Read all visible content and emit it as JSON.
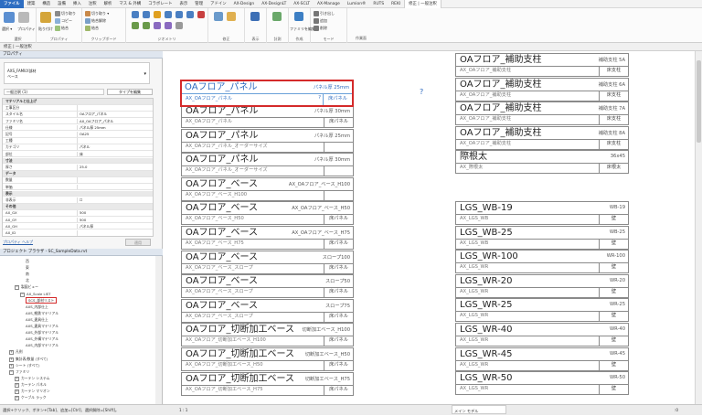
{
  "menu": [
    "ファイル",
    "建築",
    "構造",
    "設備",
    "挿入",
    "注釈",
    "解析",
    "マス & 外構",
    "コラボレート",
    "表示",
    "管理",
    "アドイン",
    "AX-Design",
    "AX-DesignLT",
    "AX-SCLT",
    "AX-Manage",
    "Lumion®",
    "RUTS",
    "REKI",
    "修正 | 一般注釈"
  ],
  "ribbon": {
    "groups": [
      "選択",
      "プロパティ",
      "クリップボード",
      "ジオメトリ",
      "修正",
      "表示",
      "計測",
      "作成",
      "モード",
      "作業面"
    ],
    "select_label": "選択 ▾",
    "prop_label": "プロパティ",
    "paste_label": "貼り付け",
    "clip_items": [
      "切り取り",
      "コピー",
      "結合"
    ],
    "geo_items": [
      "切り取り ▾",
      "結合解除",
      "結合"
    ],
    "mode_label": "ファミリを編集",
    "work_items": [
      "引き出し",
      "追加",
      "削除"
    ]
  },
  "context_bar": "修正 | 一般注釈",
  "properties": {
    "title": "プロパティ",
    "family_name": "AXS_FAMILY部材",
    "family_sub": "ベース",
    "filter": "一般注釈 (1)",
    "edit_type": "タイプを編集",
    "rows": [
      {
        "k": "マテリアルと仕上げ",
        "v": "",
        "sec": true
      },
      {
        "k": "工事区分",
        "v": ""
      },
      {
        "k": "スタイル名",
        "v": "OAフロア_パネル"
      },
      {
        "k": "ファミリ名",
        "v": "AX_OAフロア_パネル"
      },
      {
        "k": "仕様",
        "v": "パネル厚 25mm"
      },
      {
        "k": "記号",
        "v": "OA25"
      },
      {
        "k": "工種",
        "v": ""
      },
      {
        "k": "カテゴリ",
        "v": "パネル"
      },
      {
        "k": "部位",
        "v": "床"
      },
      {
        "k": "寸法",
        "v": "",
        "sec": true
      },
      {
        "k": "厚さ",
        "v": "25.0"
      },
      {
        "k": "データ",
        "v": "",
        "sec": true
      },
      {
        "k": "数量",
        "v": ""
      },
      {
        "k": "単価",
        "v": ""
      },
      {
        "k": "表示",
        "v": "",
        "sec": true
      },
      {
        "k": "非表示",
        "v": "☐"
      },
      {
        "k": "その他",
        "v": "",
        "sec": true
      },
      {
        "k": "AX_GX",
        "v": "500"
      },
      {
        "k": "AX_GY",
        "v": "500"
      },
      {
        "k": "AX_GH",
        "v": "パネル厚"
      },
      {
        "k": "AX_ID",
        "v": ""
      }
    ],
    "help_link": "プロパティ ヘルプ",
    "apply": "適用"
  },
  "browser": {
    "title": "プロジェクト ブラウザ - SC_SampleData.rvt",
    "items": [
      {
        "t": "西",
        "lvl": 4
      },
      {
        "t": "東",
        "lvl": 4
      },
      {
        "t": "南",
        "lvl": 4
      },
      {
        "t": "北",
        "lvl": 4
      },
      {
        "t": "製図ビュー",
        "lvl": 2,
        "exp": "−"
      },
      {
        "t": "AX_Scale LIST",
        "lvl": 3,
        "exp": "−"
      },
      {
        "t": "SCS_部材リスト",
        "lvl": 4,
        "hl": true
      },
      {
        "t": "AXS_内部仕上",
        "lvl": 4
      },
      {
        "t": "AXS_軽鉄マテリアル",
        "lvl": 4
      },
      {
        "t": "AXS_建具仕上",
        "lvl": 4
      },
      {
        "t": "AXS_建具マテリアル",
        "lvl": 4
      },
      {
        "t": "AXS_外部マテリアル",
        "lvl": 4
      },
      {
        "t": "AXS_外構マテリアル",
        "lvl": 4
      },
      {
        "t": "AXS_内部マテリアル",
        "lvl": 4
      },
      {
        "t": "凡例",
        "lvl": 1,
        "exp": "+"
      },
      {
        "t": "集計表/数量 (すべて)",
        "lvl": 1,
        "exp": "+"
      },
      {
        "t": "シート (すべて)",
        "lvl": 1,
        "exp": "+"
      },
      {
        "t": "ファミリ",
        "lvl": 1,
        "exp": "−"
      },
      {
        "t": "カーテン システム",
        "lvl": 2,
        "exp": "+"
      },
      {
        "t": "カーテン パネル",
        "lvl": 2,
        "exp": "+"
      },
      {
        "t": "カーテン マリオン",
        "lvl": 2,
        "exp": "+"
      },
      {
        "t": "ケーブル ラック",
        "lvl": 2,
        "exp": "+"
      }
    ]
  },
  "selected_tag": {
    "name": "OAフロア_パネル",
    "spec": "パネル厚 25mm",
    "desc": "AX_OAフロア_パネル",
    "q": "?",
    "cat": "床パネル"
  },
  "help_q": "?",
  "tags_left": [
    {
      "name": "OAフロア_パネル",
      "spec": "パネル厚 30mm",
      "desc": "AX_OAフロア_パネル",
      "cat": "床パネル"
    },
    {
      "name": "OAフロア_パネル",
      "spec": "パネル厚 25mm",
      "desc": "AX_OAフロア_パネル_オーダーサイズ",
      "cat": ""
    },
    {
      "name": "OAフロア_パネル",
      "spec": "パネル厚 30mm",
      "desc": "AX_OAフロア_パネル_オーダーサイズ",
      "cat": ""
    },
    {
      "name": "OAフロア_ベース",
      "spec": "AX_OAフロア_ベース_H100",
      "desc": "AX_OAフロア_ベース_H100",
      "cat": ""
    },
    {
      "name": "OAフロア_ベース",
      "spec": "AX_OAフロア_ベース_H50",
      "desc": "AX_OAフロア_ベース_H50",
      "cat": "床パネル"
    },
    {
      "name": "OAフロア_ベース",
      "spec": "AX_OAフロア_ベース_H75",
      "desc": "AX_OAフロア_ベース_H75",
      "cat": "床パネル"
    },
    {
      "name": "OAフロア_ベース",
      "spec": "スロープ100",
      "desc": "AX_OAフロア_ベース_スロープ",
      "cat": "床パネル"
    },
    {
      "name": "OAフロア_ベース",
      "spec": "スロープ50",
      "desc": "AX_OAフロア_ベース_スロープ",
      "cat": "床パネル"
    },
    {
      "name": "OAフロア_ベース",
      "spec": "スロープ75",
      "desc": "AX_OAフロア_ベース_スロープ",
      "cat": "床パネル"
    },
    {
      "name": "OAフロア_切断加工ベース",
      "spec": "切断加工ベース_H100",
      "desc": "AX_OAフロア_切断加工ベース_H100",
      "cat": "床パネル"
    },
    {
      "name": "OAフロア_切断加工ベース",
      "spec": "切断加工ベース_H50",
      "desc": "AX_OAフロア_切断加工ベース_H50",
      "cat": "床パネル"
    },
    {
      "name": "OAフロア_切断加工ベース",
      "spec": "切断加工ベース_H75",
      "desc": "AX_OAフロア_切断加工ベース_H75",
      "cat": "床パネル"
    }
  ],
  "tags_right": [
    {
      "name": "OAフロア_補助支柱",
      "spec": "補助支柱 5A",
      "desc": "AX_OAフロア_補助支柱",
      "cat": "床支柱"
    },
    {
      "name": "OAフロア_補助支柱",
      "spec": "補助支柱 6A",
      "desc": "AX_OAフロア_補助支柱",
      "cat": "床支柱"
    },
    {
      "name": "OAフロア_補助支柱",
      "spec": "補助支柱 7A",
      "desc": "AX_OAフロア_補助支柱",
      "cat": "床支柱"
    },
    {
      "name": "OAフロア_補助支柱",
      "spec": "補助支柱 8A",
      "desc": "AX_OAフロア_補助支柱",
      "cat": "床支柱"
    },
    {
      "name": "際根太",
      "spec": "36x45",
      "desc": "AX_際根太",
      "cat": "床根太"
    }
  ],
  "tags_lgs": [
    {
      "name": "LGS_WB-19",
      "spec": "WB-19",
      "desc": "AX_LGS_WB",
      "cat": "壁"
    },
    {
      "name": "LGS_WB-25",
      "spec": "WB-25",
      "desc": "AX_LGS_WB",
      "cat": "壁"
    },
    {
      "name": "LGS_WR-100",
      "spec": "WR-100",
      "desc": "AX_LGS_WR",
      "cat": "壁"
    },
    {
      "name": "LGS_WR-20",
      "spec": "WR-20",
      "desc": "AX_LGS_WR",
      "cat": "壁"
    },
    {
      "name": "LGS_WR-25",
      "spec": "WR-25",
      "desc": "AX_LGS_WR",
      "cat": "壁"
    },
    {
      "name": "LGS_WR-40",
      "spec": "WR-40",
      "desc": "AX_LGS_WR",
      "cat": "壁"
    },
    {
      "name": "LGS_WR-45",
      "spec": "WR-45",
      "desc": "AX_LGS_WR",
      "cat": "壁"
    },
    {
      "name": "LGS_WR-50",
      "spec": "WR-50",
      "desc": "AX_LGS_WR",
      "cat": "壁"
    }
  ],
  "status": {
    "hint": "選択+クリック、ボタン+[Tab]、追加=[Ctrl]、選択解除=[Shift]。",
    "scale": "1 : 1",
    "model": "メイン モデル",
    "zero": ":0"
  }
}
